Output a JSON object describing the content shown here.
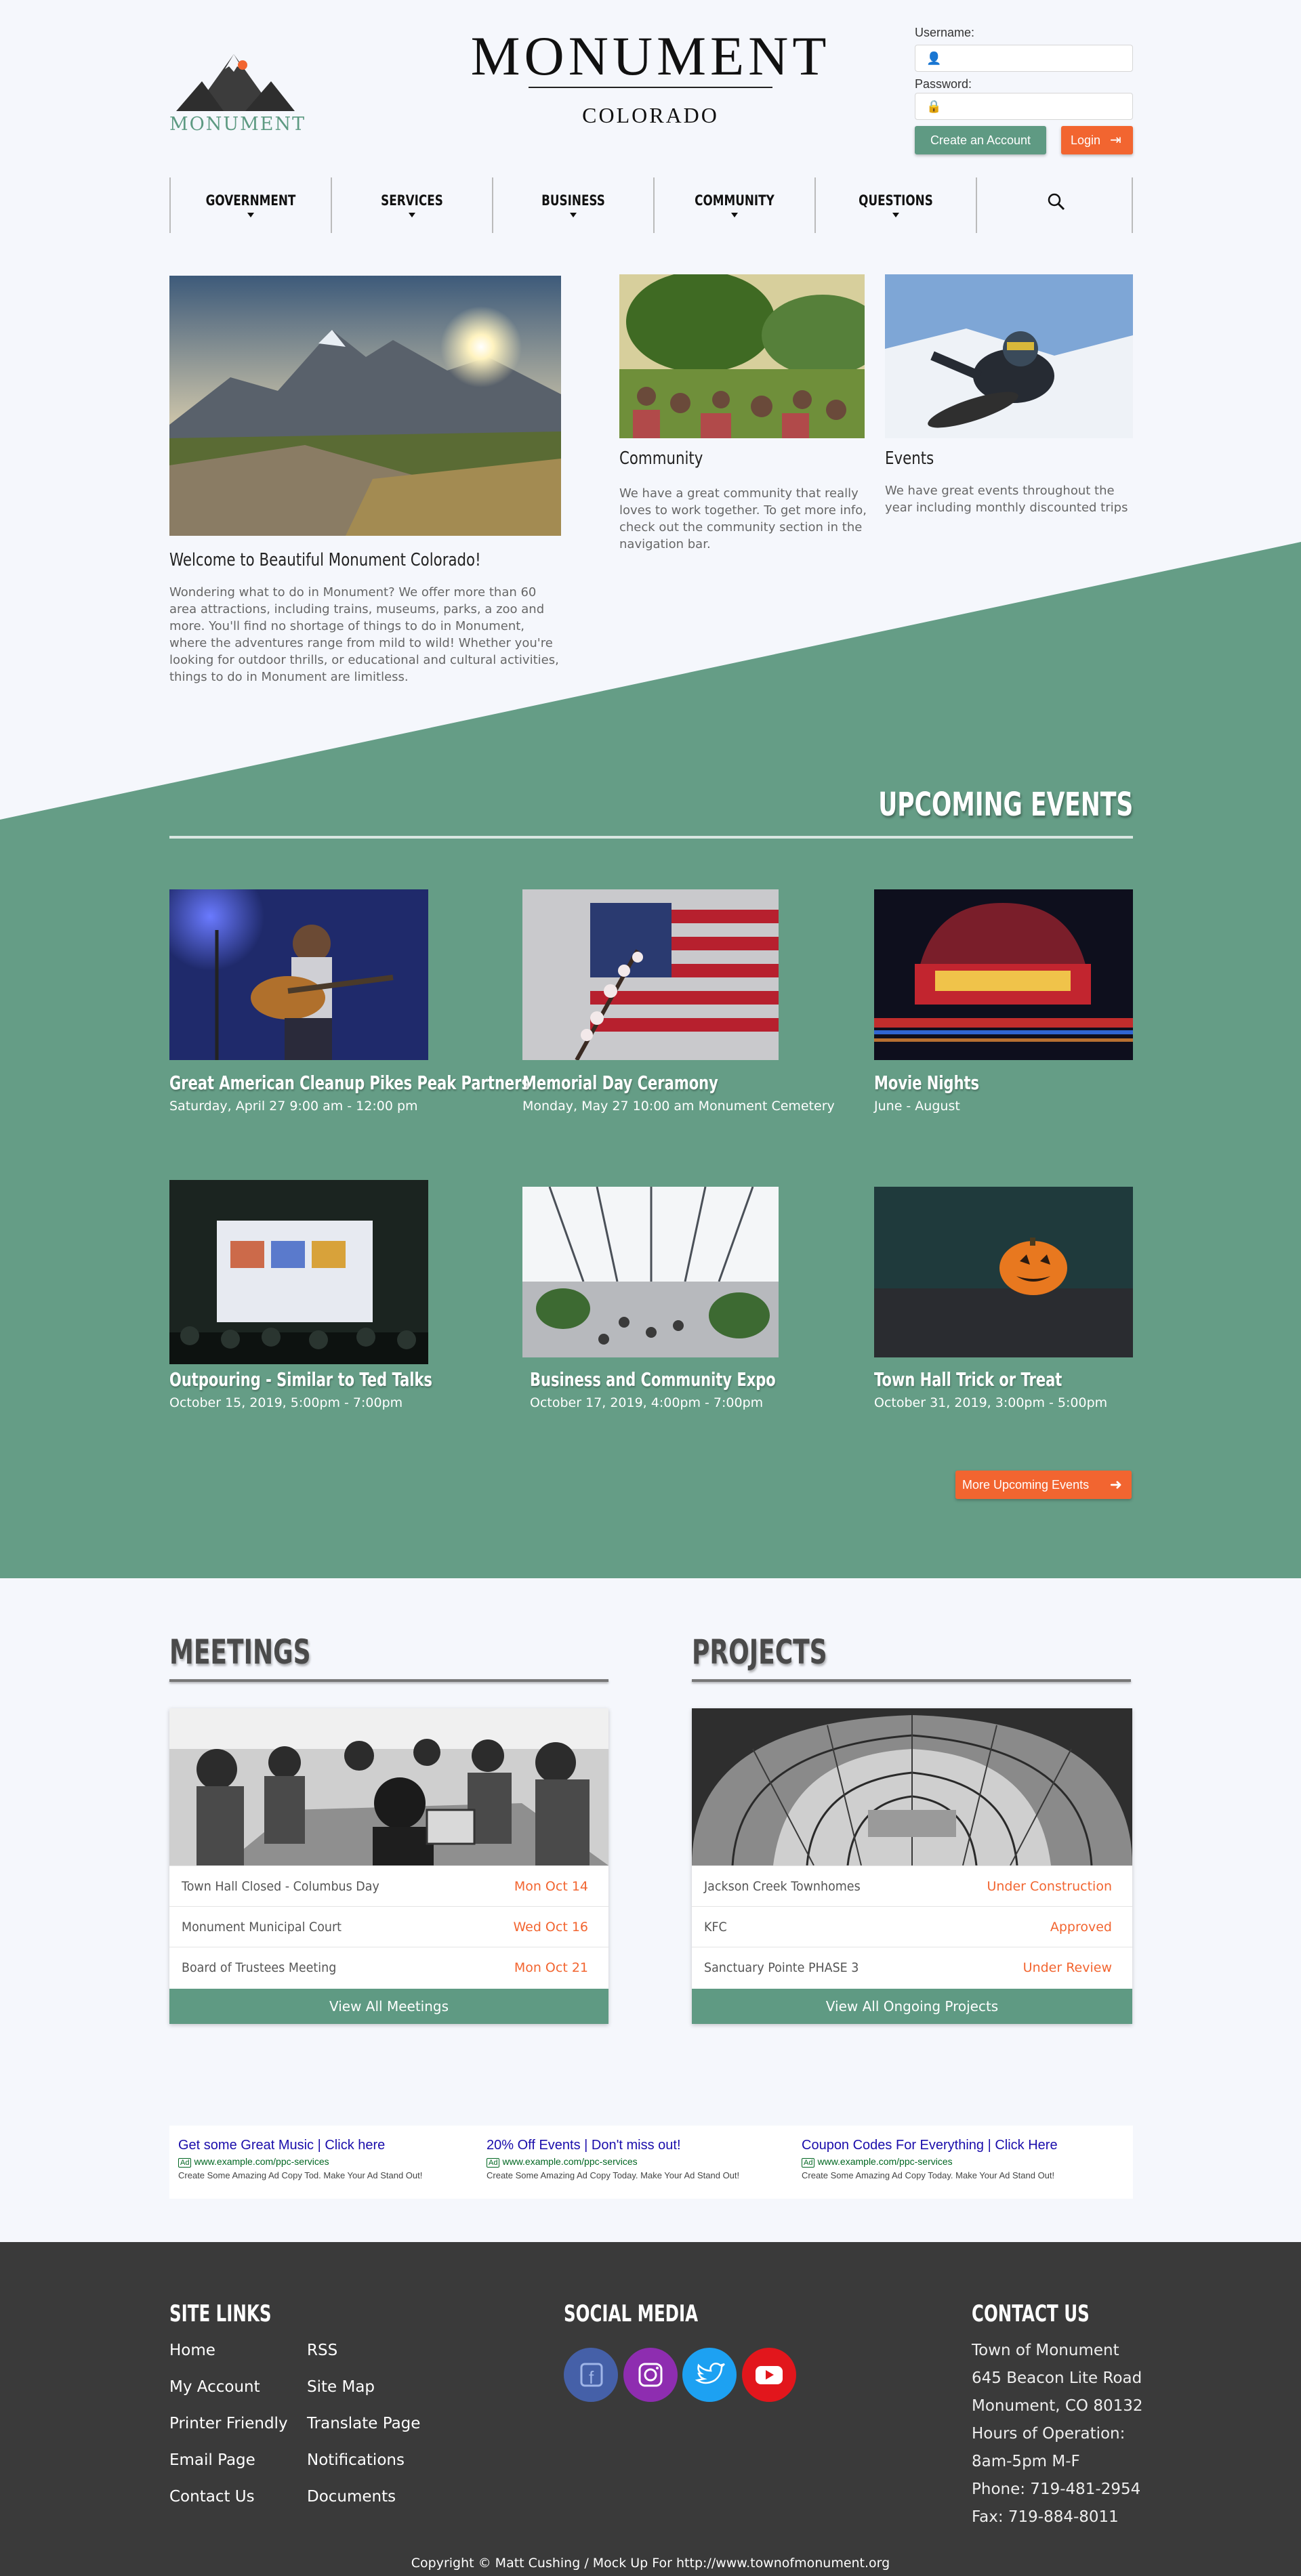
{
  "header": {
    "logo_text": "MONUMENT",
    "title": "MONUMENT",
    "subtitle": "COLORADO"
  },
  "login": {
    "username_label": "Username:",
    "password_label": "Password:",
    "create_account": "Create an Account",
    "login": "Login"
  },
  "nav": {
    "items": [
      "GOVERNMENT",
      "SERVICES",
      "BUSINESS",
      "COMMUNITY",
      "QUESTIONS"
    ],
    "search_icon": "search-icon"
  },
  "hero": {
    "main_title": "Welcome to Beautiful Monument Colorado!",
    "main_text": "Wondering what to do in Monument? We offer more than 60 area attractions, including trains, museums, parks, a zoo and more. You'll find no shortage of things to do in Monument, where the adventures range from mild to wild! Whether you're looking for outdoor thrills, or educational and cultural activities, things to do in Monument are limitless.",
    "community_title": "Community",
    "community_text": "We have a great community that really loves to work together.  To get more info, check out the community section in the navigation bar.",
    "events_title": "Events",
    "events_text": "We have great events throughout the year including monthly discounted trips"
  },
  "upcoming": {
    "title": "UPCOMING EVENTS",
    "events": [
      {
        "title": "Great American Cleanup Pikes Peak Partners",
        "date": "Saturday, April 27 9:00 am - 12:00 pm"
      },
      {
        "title": "Memorial Day Ceramony",
        "date": "Monday, May 27 10:00 am Monument Cemetery"
      },
      {
        "title": "Movie Nights",
        "date": "June - August"
      },
      {
        "title": "Outpouring - Similar to Ted Talks",
        "date": "October 15, 2019, 5:00pm - 7:00pm"
      },
      {
        "title": "Business and Community Expo",
        "date": "October 17, 2019, 4:00pm - 7:00pm"
      },
      {
        "title": "Town Hall Trick or Treat",
        "date": "October 31, 2019, 3:00pm - 5:00pm"
      }
    ],
    "more_button": "More Upcoming Events"
  },
  "meetings": {
    "title": "MEETINGS",
    "rows": [
      {
        "name": "Town Hall Closed - Columbus Day",
        "date": "Mon Oct 14"
      },
      {
        "name": "Monument Municipal Court",
        "date": "Wed Oct 16"
      },
      {
        "name": "Board of Trustees Meeting",
        "date": "Mon Oct 21"
      }
    ],
    "button": "View All Meetings"
  },
  "projects": {
    "title": "PROJECTS",
    "rows": [
      {
        "name": "Jackson Creek Townhomes",
        "status": "Under Construction"
      },
      {
        "name": "KFC",
        "status": "Approved"
      },
      {
        "name": "Sanctuary Pointe PHASE 3",
        "status": "Under Review"
      }
    ],
    "button": "View All Ongoing Projects"
  },
  "ads": [
    {
      "title": "Get some Great Music | Click here",
      "badge": "Ad",
      "url": "www.example.com/ppc-services",
      "desc": "Create Some Amazing Ad Copy Tod. Make Your Ad Stand Out!"
    },
    {
      "title": "20% Off Events | Don't miss out!",
      "badge": "Ad",
      "url": "www.example.com/ppc-services",
      "desc": "Create Some Amazing Ad Copy Today. Make Your Ad Stand Out!"
    },
    {
      "title": "Coupon Codes For Everything | Click Here",
      "badge": "Ad",
      "url": "www.example.com/ppc-services",
      "desc": "Create Some Amazing Ad Copy Today. Make Your Ad Stand Out!"
    }
  ],
  "footer": {
    "site_links_title": "SITE LINKS",
    "links_col1": [
      "Home",
      "My Account",
      "Printer Friendly",
      "Email Page",
      "Contact Us"
    ],
    "links_col2": [
      "RSS",
      "Site Map",
      "Translate Page",
      "Notifications",
      "Documents"
    ],
    "social_title": "SOCIAL MEDIA",
    "social_icons": [
      "facebook-icon",
      "instagram-icon",
      "twitter-icon",
      "youtube-icon"
    ],
    "contact_title": "CONTACT US",
    "contact_lines": [
      "Town of Monument",
      "645 Beacon Lite Road",
      "Monument, CO 80132",
      "Hours of Operation:",
      "8am-5pm M-F",
      "Phone: 719-481-2954",
      "Fax: 719-884-8011"
    ],
    "copyright": "Copyright © Matt Cushing / Mock Up For http://www.townofmonument.org"
  },
  "colors": {
    "brand_green": "#5f9a83",
    "accent_orange": "#f26530",
    "footer_dark": "#3a3a3a"
  }
}
